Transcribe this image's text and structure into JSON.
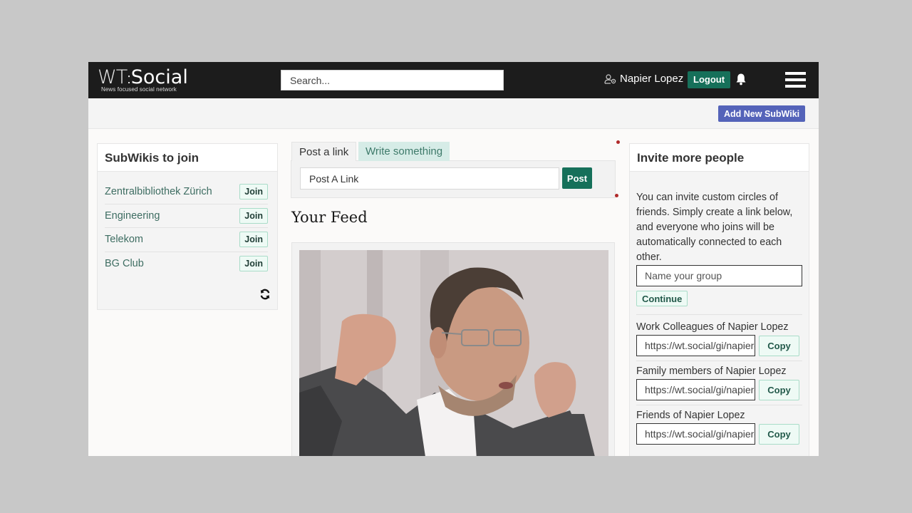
{
  "header": {
    "logo_wt": "WT",
    "logo_colon": ":",
    "logo_social": "Social",
    "tagline": "News focused social network",
    "search_placeholder": "Search...",
    "user_name": "Napier Lopez",
    "logout_label": "Logout"
  },
  "subheader": {
    "add_subwiki_label": "Add New SubWiki"
  },
  "subwikis": {
    "title": "SubWikis to join",
    "join_label": "Join",
    "items": [
      {
        "name": "Zentralbibliothek Zürich"
      },
      {
        "name": "Engineering"
      },
      {
        "name": "Telekom"
      },
      {
        "name": "BG Club"
      }
    ]
  },
  "composer": {
    "tabs": [
      {
        "label": "Post a link",
        "active": true
      },
      {
        "label": "Write something",
        "active": false
      }
    ],
    "input_placeholder": "Post A Link",
    "post_label": "Post"
  },
  "feed": {
    "title": "Your Feed"
  },
  "invite": {
    "title": "Invite more people",
    "description": "You can invite custom circles of friends. Simply create a link below, and everyone who joins will be automatically connected to each other.",
    "group_placeholder": "Name your group",
    "continue_label": "Continue",
    "copy_label": "Copy",
    "circles": [
      {
        "label": "Work Colleagues of Napier Lopez",
        "link": "https://wt.social/gi/napier-lopez"
      },
      {
        "label": "Family members of Napier Lopez",
        "link": "https://wt.social/gi/napier-lopez"
      },
      {
        "label": "Friends of Napier Lopez",
        "link": "https://wt.social/gi/napier-lopez"
      }
    ]
  },
  "colors": {
    "topbar": "#1c1c1c",
    "primary_green": "#16705a",
    "subwiki_button": "#5463b9",
    "tab_write_bg": "#d6ece7"
  }
}
